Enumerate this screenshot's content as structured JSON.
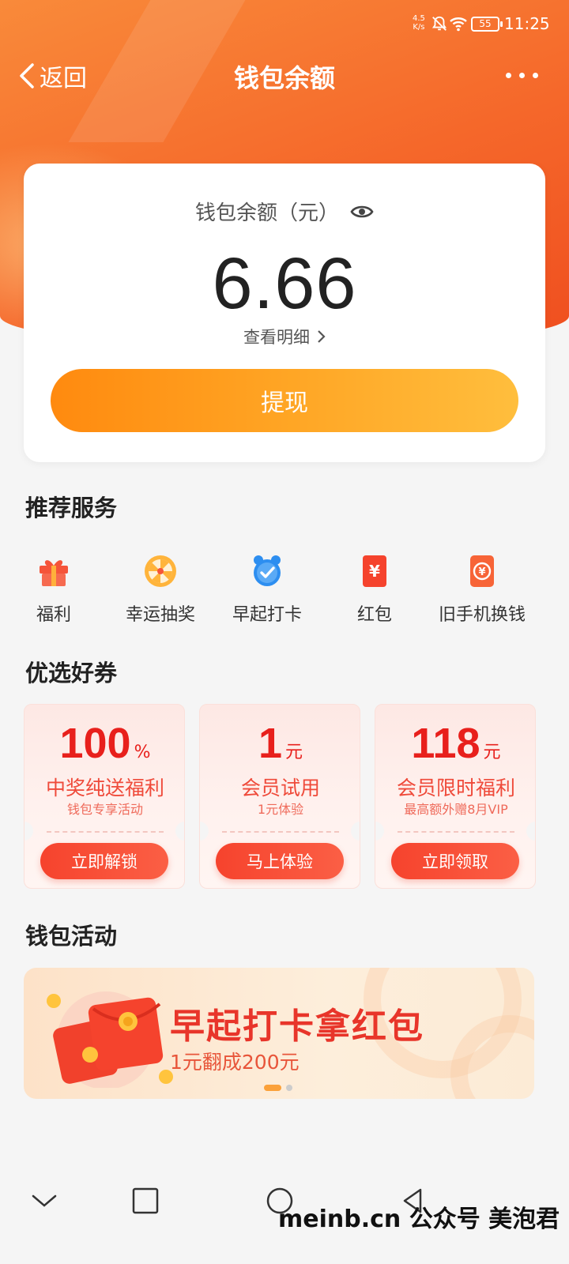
{
  "status_bar": {
    "speed_top": "4.5",
    "speed_bottom": "K/s",
    "battery": "55",
    "time": "11:25"
  },
  "nav": {
    "back_label": "返回",
    "title": "钱包余额"
  },
  "balance": {
    "label": "钱包余额（元）",
    "amount": "6.66",
    "detail_link": "查看明细",
    "withdraw_button": "提现"
  },
  "services": {
    "title": "推荐服务",
    "items": [
      {
        "label": "福利",
        "icon": "gift-icon"
      },
      {
        "label": "幸运抽奖",
        "icon": "lucky-wheel-icon"
      },
      {
        "label": "早起打卡",
        "icon": "alarm-clock-icon"
      },
      {
        "label": "红包",
        "icon": "red-packet-icon"
      },
      {
        "label": "旧手机换钱",
        "icon": "trade-in-icon"
      }
    ]
  },
  "coupons": {
    "title": "优选好券",
    "items": [
      {
        "value": "100",
        "unit": "%",
        "title": "中奖纯送福利",
        "subtitle": "钱包专享活动",
        "button": "立即解锁"
      },
      {
        "value": "1",
        "unit": "元",
        "title": "会员试用",
        "subtitle": "1元体验",
        "button": "马上体验"
      },
      {
        "value": "118",
        "unit": "元",
        "title": "会员限时福利",
        "subtitle": "最高额外赠8月VIP",
        "button": "立即领取"
      }
    ]
  },
  "activities": {
    "title": "钱包活动",
    "banner": {
      "title": "早起打卡拿红包",
      "subtitle": "1元翻成200元",
      "current_slide": 1,
      "slide_count": 2
    }
  },
  "watermark": "meinb.cn 公众号 美泡君",
  "colors": {
    "header_orange": "#f5672a",
    "accent_red": "#e8201c",
    "withdraw_gradient_start": "#ff8a0f",
    "withdraw_gradient_end": "#ffbe3d"
  }
}
